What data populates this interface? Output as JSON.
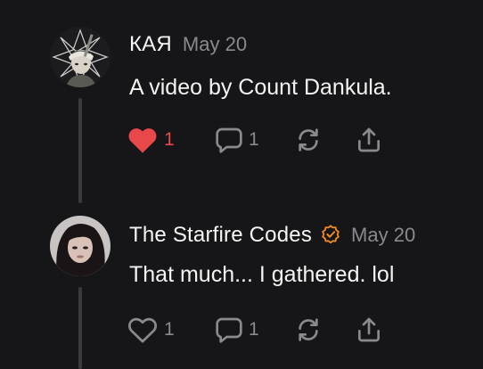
{
  "posts": [
    {
      "author": "КАЯ",
      "date": "May 20",
      "text": "A video by Count Dankula.",
      "liked": true,
      "like_count": "1",
      "reply_count": "1",
      "verified": false,
      "avatar_icon": "avatar-kaya-icon"
    },
    {
      "author": "The Starfire Codes",
      "date": "May 20",
      "text": "That much... I gathered. lol",
      "liked": false,
      "like_count": "1",
      "reply_count": "1",
      "verified": true,
      "avatar_icon": "avatar-starfire-icon"
    }
  ],
  "colors": {
    "background": "#161618",
    "like_red": "#e8484a",
    "verified_orange": "#f08a24",
    "muted": "#8a8a8e",
    "thread_line": "#3a3a3c"
  }
}
